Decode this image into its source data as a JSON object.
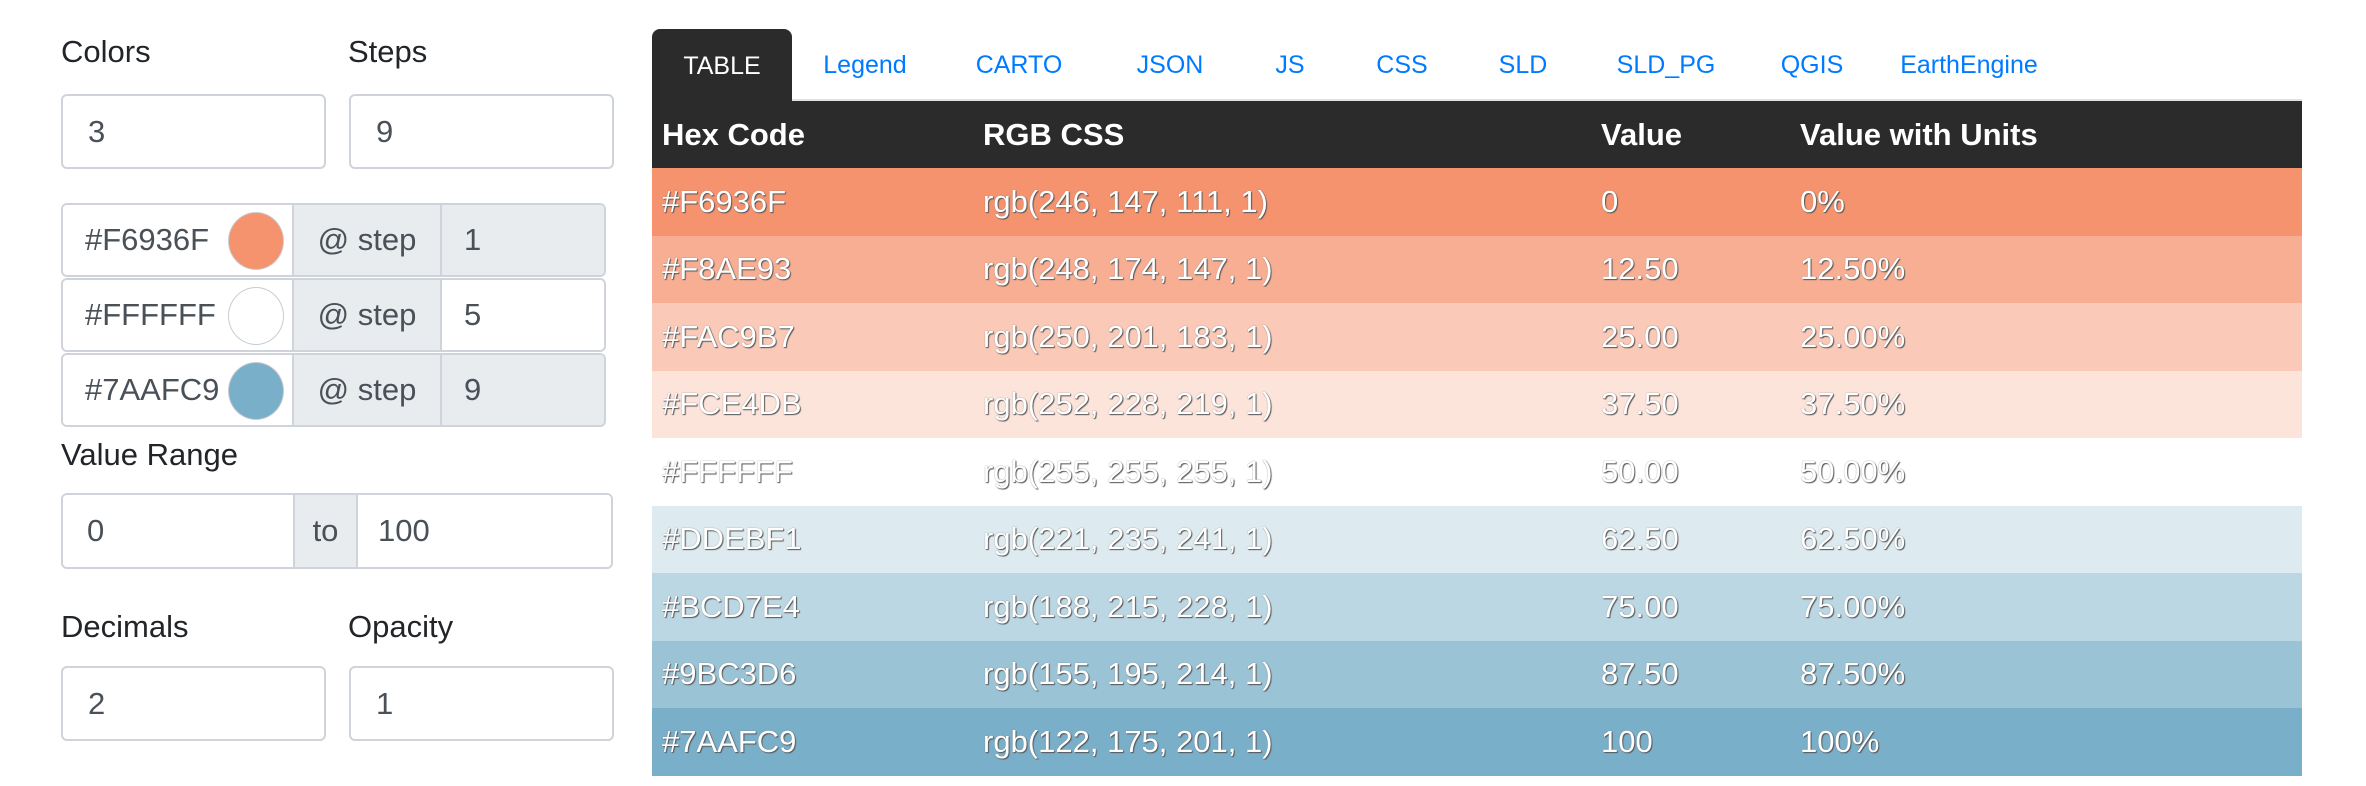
{
  "controls": {
    "colors": {
      "label": "Colors",
      "value": "3"
    },
    "steps": {
      "label": "Steps",
      "value": "9"
    },
    "color_stops": [
      {
        "hex": "#F6936F",
        "swatch": "#F6936F",
        "addon": "@ step",
        "step": "1",
        "editable": false
      },
      {
        "hex": "#FFFFFF",
        "swatch": "#FFFFFF",
        "addon": "@ step",
        "step": "5",
        "editable": true
      },
      {
        "hex": "#7AAFC9",
        "swatch": "#7AAFC9",
        "addon": "@ step",
        "step": "9",
        "editable": false
      }
    ],
    "value_range": {
      "label": "Value Range",
      "from": "0",
      "separator": "to",
      "to": "100"
    },
    "decimals": {
      "label": "Decimals",
      "value": "2"
    },
    "opacity": {
      "label": "Opacity",
      "value": "1"
    }
  },
  "tabs": [
    {
      "label": "TABLE",
      "active": true
    },
    {
      "label": "Legend",
      "active": false
    },
    {
      "label": "CARTO",
      "active": false
    },
    {
      "label": "JSON",
      "active": false
    },
    {
      "label": "JS",
      "active": false
    },
    {
      "label": "CSS",
      "active": false
    },
    {
      "label": "SLD",
      "active": false
    },
    {
      "label": "SLD_PG",
      "active": false
    },
    {
      "label": "QGIS",
      "active": false
    },
    {
      "label": "EarthEngine",
      "active": false
    }
  ],
  "table": {
    "headers": [
      "Hex Code",
      "RGB CSS",
      "Value",
      "Value with Units"
    ],
    "rows": [
      {
        "hex": "#F6936F",
        "rgb": "rgb(246, 147, 111, 1)",
        "value": "0",
        "units": "0%"
      },
      {
        "hex": "#F8AE93",
        "rgb": "rgb(248, 174, 147, 1)",
        "value": "12.50",
        "units": "12.50%"
      },
      {
        "hex": "#FAC9B7",
        "rgb": "rgb(250, 201, 183, 1)",
        "value": "25.00",
        "units": "25.00%"
      },
      {
        "hex": "#FCE4DB",
        "rgb": "rgb(252, 228, 219, 1)",
        "value": "37.50",
        "units": "37.50%"
      },
      {
        "hex": "#FFFFFF",
        "rgb": "rgb(255, 255, 255, 1)",
        "value": "50.00",
        "units": "50.00%"
      },
      {
        "hex": "#DDEBF1",
        "rgb": "rgb(221, 235, 241, 1)",
        "value": "62.50",
        "units": "62.50%"
      },
      {
        "hex": "#BCD7E4",
        "rgb": "rgb(188, 215, 228, 1)",
        "value": "75.00",
        "units": "75.00%"
      },
      {
        "hex": "#9BC3D6",
        "rgb": "rgb(155, 195, 214, 1)",
        "value": "87.50",
        "units": "87.50%"
      },
      {
        "hex": "#7AAFC9",
        "rgb": "rgb(122, 175, 201, 1)",
        "value": "100",
        "units": "100%"
      }
    ]
  },
  "theme": {
    "link_color": "#007bff",
    "header_bg": "#2b2b2b",
    "addon_bg": "#e9ecef",
    "border": "#ced4da"
  }
}
